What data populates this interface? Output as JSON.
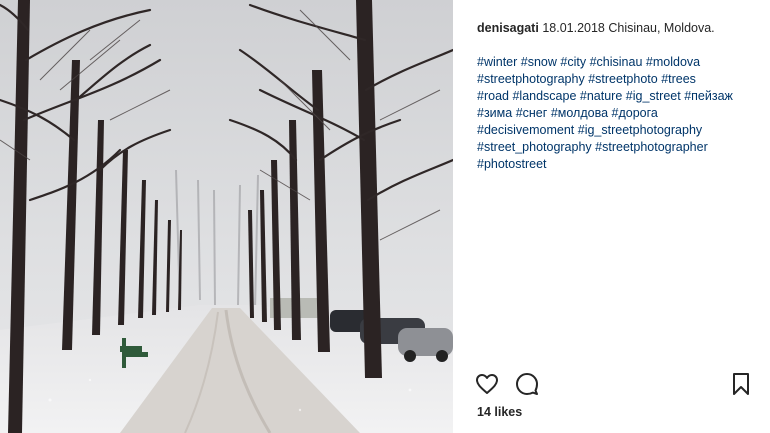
{
  "post": {
    "username": "denisagati",
    "caption_text": "18.01.2018 Chisinau, Moldova.",
    "hashtag_lines": [
      [
        "#winter",
        "#snow",
        "#city",
        "#chisinau",
        "#moldova"
      ],
      [
        "#streetphotography",
        "#streetphoto",
        "#trees"
      ],
      [
        "#road",
        "#landscape",
        "#nature",
        "#ig_street",
        "#пейзаж"
      ],
      [
        "#зима",
        "#снег",
        "#молдова",
        "#дорога"
      ],
      [
        "#decisivemoment",
        "#ig_streetphotography"
      ],
      [
        "#street_photography",
        "#streetphotographer"
      ],
      [
        "#photostreet"
      ]
    ],
    "likes_text": "14 likes"
  },
  "icons": {
    "like": "heart-icon",
    "comment": "comment-bubble-icon",
    "save": "bookmark-icon"
  },
  "colors": {
    "hashtag": "#003569",
    "text": "#262626"
  }
}
